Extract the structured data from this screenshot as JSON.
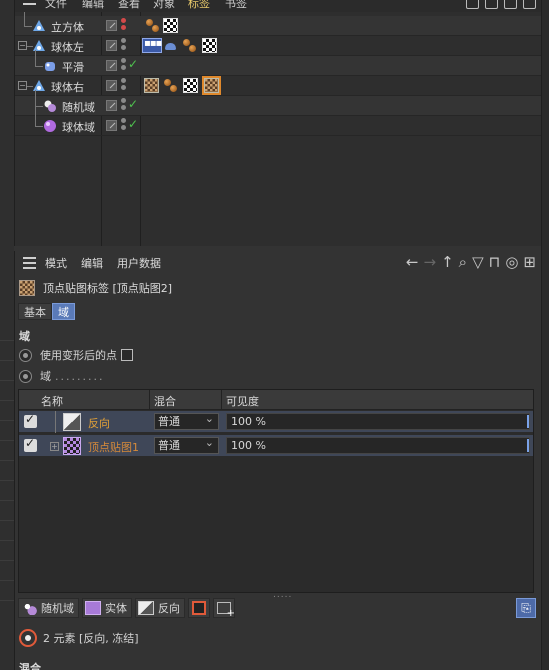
{
  "object_manager": {
    "menus": [
      "文件",
      "编辑",
      "查看",
      "对象",
      "标签",
      "书签"
    ],
    "active_menu": "标签",
    "objects": [
      {
        "name": "立方体",
        "icon": "cube-icon",
        "indent": 1,
        "dots": "red",
        "check": false,
        "tags": [
          "balls",
          "checker"
        ]
      },
      {
        "name": "球体左",
        "icon": "sphere-icon",
        "indent": 0,
        "dots": "gray",
        "check": false,
        "tags": [
          "chain",
          "hat",
          "balls",
          "checker"
        ]
      },
      {
        "name": "平滑",
        "icon": "smooth-deformer-icon",
        "indent": 2,
        "dots": "gray",
        "check": true,
        "tags": []
      },
      {
        "name": "球体右",
        "icon": "sphere-icon",
        "indent": 0,
        "dots": "gray",
        "check": false,
        "tags": [
          "checker-tex",
          "balls",
          "checker",
          "checker-sel"
        ]
      },
      {
        "name": "随机域",
        "icon": "random-field-icon",
        "indent": 2,
        "dots": "gray",
        "check": true,
        "tags": []
      },
      {
        "name": "球体域",
        "icon": "sphere-field-icon",
        "indent": 2,
        "dots": "gray",
        "check": true,
        "tags": []
      }
    ]
  },
  "attribute_manager": {
    "menus": [
      "模式",
      "编辑",
      "用户数据"
    ],
    "tag_title": "顶点贴图标签 [顶点贴图2]",
    "tabs": [
      {
        "label": "基本",
        "active": false
      },
      {
        "label": "域",
        "active": true
      }
    ],
    "section_fields": "域",
    "options": {
      "use_deformed_points": "使用变形后的点",
      "fields_label": "域",
      "fields_dots": "........."
    },
    "field_list": {
      "headers": {
        "name": "名称",
        "blend": "混合",
        "visibility": "可见度"
      },
      "rows": [
        {
          "name": "反向",
          "blend": "普通",
          "visibility": "100 %"
        },
        {
          "name": "顶点贴图1",
          "blend": "普通",
          "visibility": "100 %"
        }
      ],
      "resize_dots": "....."
    },
    "toolbar": {
      "random_field": "随机域",
      "solid": "实体",
      "invert": "反向"
    },
    "status_text": "2 元素 [反向, 冻结]",
    "section_blend": "混合"
  }
}
